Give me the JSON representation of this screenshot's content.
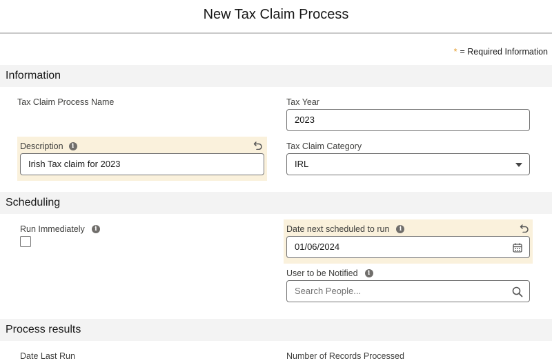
{
  "header": {
    "title": "New Tax Claim Process"
  },
  "required_note": {
    "star": "*",
    "text": "= Required Information"
  },
  "sections": {
    "information": {
      "title": "Information",
      "process_name_label": "Tax Claim Process Name",
      "tax_year_label": "Tax Year",
      "tax_year_value": "2023",
      "description_label": "Description",
      "description_value": "Irish Tax claim for 2023",
      "category_label": "Tax Claim Category",
      "category_value": "IRL"
    },
    "scheduling": {
      "title": "Scheduling",
      "run_immediately_label": "Run Immediately",
      "run_immediately_checked": false,
      "next_run_label": "Date next scheduled to run",
      "next_run_value": "01/06/2024",
      "notify_label": "User to be Notified",
      "notify_placeholder": "Search People..."
    },
    "results": {
      "title": "Process results",
      "date_last_run_label": "Date Last Run",
      "records_processed_label": "Number of Records Processed"
    }
  },
  "icons": {
    "info": "info-icon",
    "undo": "undo-icon",
    "calendar": "calendar-icon",
    "search": "search-icon",
    "dropdown": "chevron-down-icon"
  },
  "colors": {
    "required_star": "#e49c2c",
    "highlight": "#faf1dc",
    "section_bg": "#f3f3f3"
  }
}
